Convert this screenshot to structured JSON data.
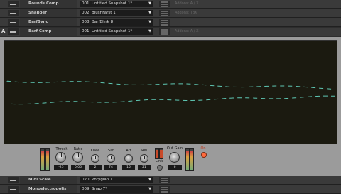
{
  "tracks_top": [
    {
      "a": "",
      "name": "Rounds Comp",
      "num": "001",
      "preset": "Untitled Snapshot 1*",
      "extra": "Addons: A / X"
    },
    {
      "a": "",
      "name": "Snapper",
      "num": "002",
      "preset": "BlushFarst 1",
      "extra": "Addons: TBK"
    },
    {
      "a": "",
      "name": "BarfSync",
      "num": "008",
      "preset": "BarfBlink 8",
      "extra": ""
    },
    {
      "a": "A",
      "name": "Barf Comp",
      "num": "001",
      "preset": "Untitled Snapshot 1*",
      "extra": "Addons: A / X"
    }
  ],
  "tracks_bottom": [
    {
      "a": "",
      "name": "Midi Scale",
      "num": "020",
      "preset": "Phrygian 1",
      "extra": ""
    },
    {
      "a": "",
      "name": "Monoelectropolis",
      "num": "009",
      "preset": "Snap 7*",
      "extra": ""
    }
  ],
  "dropdown_arrow": "▼",
  "controls": {
    "thresh": {
      "label": "Thresh",
      "value": "-25"
    },
    "ratio": {
      "label": "Ratio",
      "value": "0.05"
    },
    "knee": {
      "label": "Knee",
      "value": "2"
    },
    "sat": {
      "label": "Sat",
      "value": "74"
    },
    "att": {
      "label": "Att",
      "value": "15"
    },
    "rel": {
      "label": "Rel",
      "value": "21"
    },
    "link": {
      "label": "Link"
    },
    "out_gain": {
      "label": "Out Gain",
      "value": "6"
    },
    "on": {
      "label": "On"
    }
  },
  "colors": {
    "scope_bg": "#1b1a10",
    "trace": "#5fc8b4",
    "led_on": "#ff6a3d"
  }
}
